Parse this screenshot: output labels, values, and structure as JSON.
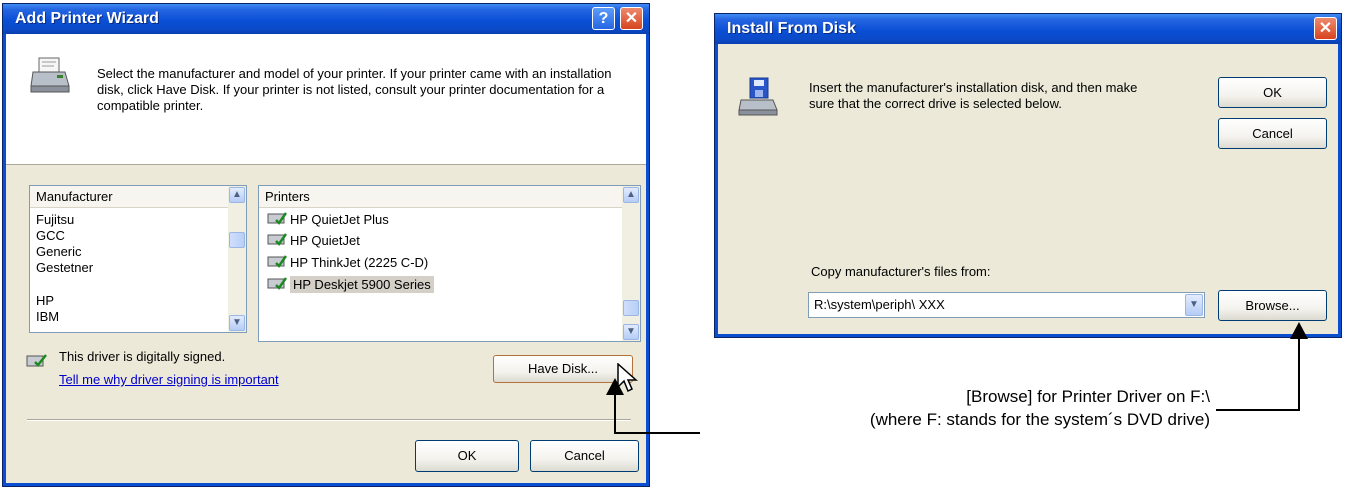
{
  "wizard": {
    "title": "Add Printer Wizard",
    "help_glyph": "?",
    "close_glyph": "✕",
    "instructions": "Select the manufacturer and model of your printer. If your printer came with an installation disk, click Have Disk. If your printer is not listed, consult your printer documentation for a compatible printer.",
    "manufacturer_header": "Manufacturer",
    "manufacturers": [
      "Fujitsu",
      "GCC",
      "Generic",
      "Gestetner",
      "HP",
      "IBM"
    ],
    "selected_manufacturer": "HP",
    "printers_header": "Printers",
    "printers": [
      "HP QuietJet Plus",
      "HP QuietJet",
      "HP ThinkJet (2225 C-D)",
      "HP Deskjet 5900 Series"
    ],
    "selected_printer": "HP Deskjet 5900 Series",
    "signed_text": "This driver is digitally signed.",
    "signing_link": "Tell me why driver signing is important",
    "have_disk_label": "Have Disk...",
    "ok_label": "OK",
    "cancel_label": "Cancel"
  },
  "install": {
    "title": "Install From Disk",
    "close_glyph": "✕",
    "instructions": "Insert the manufacturer's installation disk, and then make sure that the correct drive is selected below.",
    "ok_label": "OK",
    "cancel_label": "Cancel",
    "copy_label": "Copy manufacturer's files from:",
    "path_value": "R:\\system\\periph\\ XXX",
    "browse_label": "Browse..."
  },
  "annotation": {
    "line1": "[Browse] for Printer Driver on F:\\",
    "line2": "(where F: stands for the system´s DVD drive)"
  },
  "icons": {
    "printer": "printer-icon",
    "disk": "install-disk-icon",
    "signed": "signed-driver-icon",
    "cursor": "mouse-pointer-icon"
  }
}
